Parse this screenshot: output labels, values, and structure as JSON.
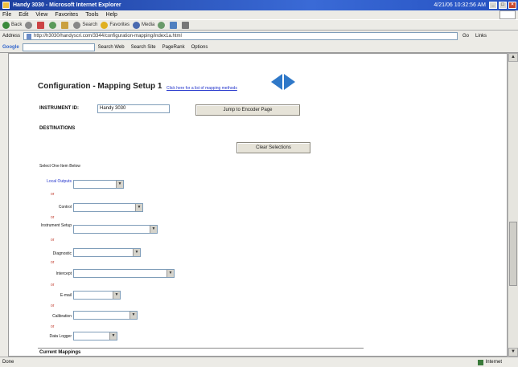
{
  "window": {
    "title": "Handy 3030 - Microsoft Internet Explorer",
    "clock": "4/21/06 10:32:56 AM"
  },
  "menu": [
    "File",
    "Edit",
    "View",
    "Favorites",
    "Tools",
    "Help"
  ],
  "toolbar": {
    "back": "Back",
    "search": "Search",
    "favorites": "Favorites",
    "media": "Media"
  },
  "address": {
    "label": "Address",
    "url": "http://h3030/handyscri.com/3344/configuration-mapping/index1a.html",
    "go": "Go",
    "links": "Links"
  },
  "google": {
    "label": "Google",
    "search_web": "Search Web",
    "search_site": "Search Site",
    "pagerank": "PageRank",
    "options": "Options"
  },
  "page": {
    "title": "Configuration - Mapping Setup 1",
    "help_link": "Click here for a list of mapping methods",
    "instrument_label": "INSTRUMENT ID:",
    "instrument_value": "Handy 3030",
    "jump_button": "Jump to Encoder Page",
    "destinations_label": "DESTINATIONS",
    "clear_button": "Clear Selections",
    "select_one": "Select One Item Below",
    "or_text": "or",
    "fields": [
      {
        "label": "Local Outputs"
      },
      {
        "label": "Control"
      },
      {
        "label": "Instrument Setup"
      },
      {
        "label": "Diagnostic"
      },
      {
        "label": "Intercept"
      },
      {
        "label": "E-mail"
      },
      {
        "label": "Calibration"
      },
      {
        "label": "Data Logger"
      }
    ],
    "current_mappings_label": "Current Mappings"
  },
  "status": {
    "left": "Done",
    "zone": "Internet"
  },
  "colors": {
    "titlebar": "#2450c0",
    "link": "#2233cc",
    "arrow": "#2f78c8"
  }
}
